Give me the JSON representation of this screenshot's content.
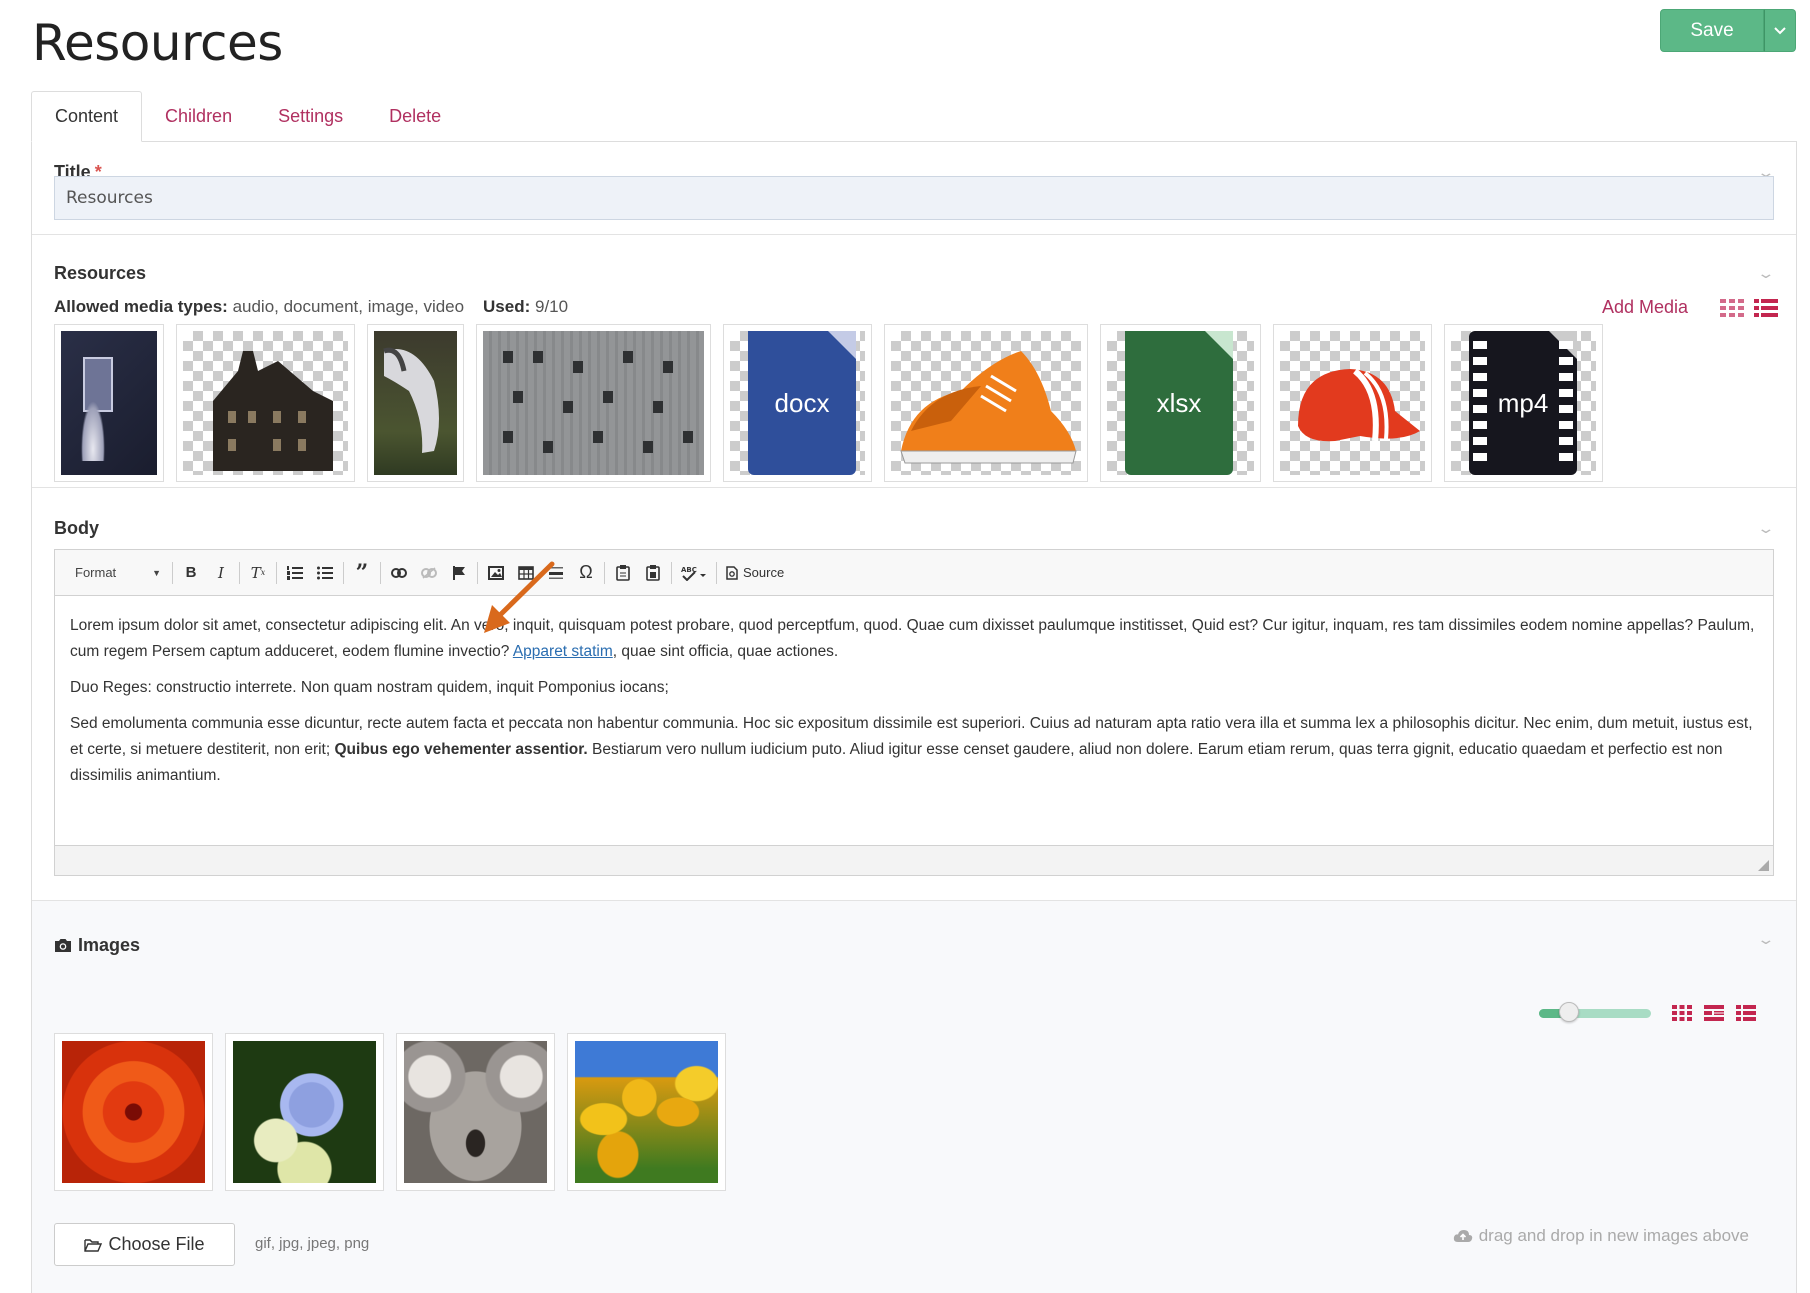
{
  "page": {
    "title": "Resources"
  },
  "save": {
    "label": "Save"
  },
  "tabs": [
    {
      "label": "Content",
      "active": true
    },
    {
      "label": "Children"
    },
    {
      "label": "Settings"
    },
    {
      "label": "Delete"
    }
  ],
  "title_field": {
    "label": "Title",
    "required_mark": "*",
    "value": "Resources"
  },
  "resources": {
    "label": "Resources",
    "allowed_label": "Allowed media types:",
    "allowed_value": "audio, document, image, video",
    "used_label": "Used:",
    "used_value": "9/10",
    "add_media": "Add Media",
    "items": [
      {
        "kind": "image",
        "name": "woman-window"
      },
      {
        "kind": "image",
        "name": "haunted-house"
      },
      {
        "kind": "image",
        "name": "horse"
      },
      {
        "kind": "image",
        "name": "building-facade"
      },
      {
        "kind": "file",
        "ext": "docx",
        "color": "#2f4f9b"
      },
      {
        "kind": "image",
        "name": "sneakers"
      },
      {
        "kind": "file",
        "ext": "xlsx",
        "color": "#2e6d3d"
      },
      {
        "kind": "image",
        "name": "red-cap"
      },
      {
        "kind": "file",
        "ext": "mp4",
        "color": "#16161e"
      }
    ]
  },
  "body": {
    "label": "Body",
    "toolbar": {
      "format": "Format",
      "source": "Source",
      "icons": [
        "bold-icon",
        "italic-icon",
        "clear-format-icon",
        "numbered-list-icon",
        "bulleted-list-icon",
        "blockquote-icon",
        "link-icon",
        "unlink-icon",
        "anchor-flag-icon",
        "image-icon",
        "table-icon",
        "horizontal-line-icon",
        "special-char-icon",
        "paste-icon",
        "paste-text-icon",
        "spellcheck-icon",
        "source-icon"
      ]
    },
    "p1_a": "Lorem ipsum dolor sit amet, consectetur adipiscing elit. An vero, inquit, quisquam potest probare, quod perceptfum, quod. Quae cum dixisset paulumque institisset, Quid est? Cur igitur, inquam, res tam dissimiles eodem nomine appellas? Paulum, cum regem Persem captum adduceret, eodem flumine invectio? ",
    "p1_link": "Apparet statim",
    "p1_b": ", quae sint officia, quae actiones.",
    "p2": "Duo Reges: constructio interrete. Non quam nostram quidem, inquit Pomponius iocans;",
    "p3_a": "Sed emolumenta communia esse dicuntur, recte autem facta et peccata non habentur communia. Hoc sic expositum dissimile est superiori. Cuius ad naturam apta ratio vera illa et summa lex a philosophis dicitur. Nec enim, dum metuit, iustus est, et certe, si metuere destiterit, non erit; ",
    "p3_bold": "Quibus ego vehementer assentior.",
    "p3_b": " Bestiarum vero nullum iudicium puto. Aliud igitur esse censet gaudere, aliud non dolere. Earum etiam rerum, quas terra gignit, educatio quaedam et perfectio est non dissimilis animantium."
  },
  "images": {
    "label": "Images",
    "slider_level": 0.27,
    "items": [
      "red-flower",
      "hydrangea",
      "koala",
      "tulips"
    ],
    "choose_file": "Choose File",
    "file_types": "gif, jpg, jpeg, png",
    "drop_hint": "drag and drop in new images above"
  },
  "colors": {
    "accent": "#b03060",
    "save": "#5cb887",
    "annotation_arrow": "#d9691c"
  }
}
